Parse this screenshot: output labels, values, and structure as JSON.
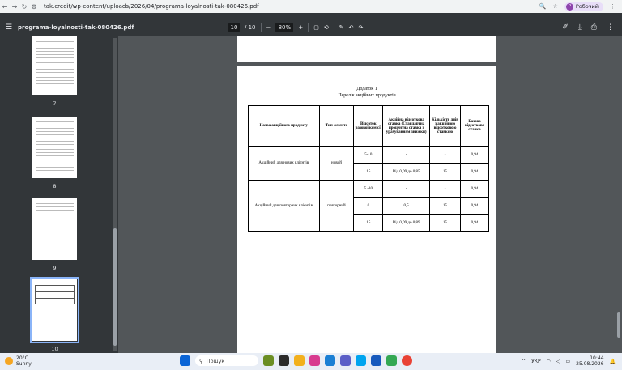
{
  "browser": {
    "url_domain": "tak.credit",
    "url_path": "/wp-content/uploads/2026/04/programa-loyalnosti-tak-080426.pdf",
    "profile_name": "Робочий",
    "profile_initial": "Р"
  },
  "pdf_toolbar": {
    "file_name": "programa-loyalnosti-tak-080426.pdf",
    "current_page": "10",
    "total_pages": "/ 10",
    "zoom": "80%"
  },
  "thumbnails": [
    {
      "label": "7"
    },
    {
      "label": "8"
    },
    {
      "label": "9"
    },
    {
      "label": "10"
    }
  ],
  "document": {
    "appendix": "Додаток 1",
    "list_title": "Перелік акційних продуктів",
    "headers": [
      "Назва акційного продукту",
      "Тип клієнта",
      "Відсоток разової комісії",
      "Акційна відсоткова ставка (Стандартна процентна ставка з урахуванням знижки)",
      "Кількість днів з акційною відсотковою ставкою",
      "Базова відсоткова ставка"
    ],
    "group1": {
      "product": "Акційний для нових клієнтів",
      "client_type": "новий",
      "rows": [
        [
          "5-10",
          "-",
          "-",
          "0,94"
        ],
        [
          "15",
          "Від 0,09 до 0,85",
          "15",
          "0,94"
        ]
      ]
    },
    "group2": {
      "product": "Акційний для повторних клієнтів",
      "client_type": "повторний",
      "rows": [
        [
          "5 -10",
          "-",
          "-",
          "0,94"
        ],
        [
          "0",
          "0,5",
          "15",
          "0,94"
        ],
        [
          "15",
          "Від 0,09 до 0,89",
          "15",
          "0,94"
        ]
      ]
    }
  },
  "taskbar": {
    "temperature": "20°C",
    "weather": "Sunny",
    "search_placeholder": "Пошук",
    "language": "УКР",
    "time": "10:44",
    "date": "25.08.2026"
  }
}
